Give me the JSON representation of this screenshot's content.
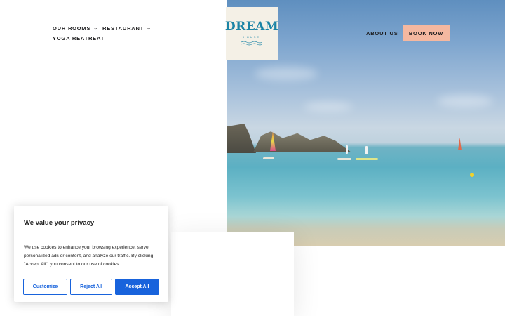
{
  "nav": {
    "left_items": [
      {
        "label": "OUR ROOMS",
        "has_dropdown": true
      },
      {
        "label": "RESTAURANT",
        "has_dropdown": true
      },
      {
        "label": "YOGA REATREAT",
        "has_dropdown": false
      }
    ],
    "right_items": [
      {
        "label": "ABOUT US"
      }
    ],
    "book_now": "BOOK NOW"
  },
  "logo": {
    "word": "DREAM",
    "sub": "HOUSE",
    "icon": "waves-icon"
  },
  "hero": {
    "image_icon": "beach-photo"
  },
  "cookie_banner": {
    "title": "We value your privacy",
    "text": "We use cookies to enhance your browsing experience, serve personalized ads or content, and analyze our traffic. By clicking \"Accept All\", you consent to our use of cookies.",
    "buttons": {
      "customize": "Customize",
      "reject": "Reject All",
      "accept": "Accept All"
    }
  },
  "colors": {
    "accent_button": "#f5b8a0",
    "logo_blue": "#1b84a6",
    "cookie_blue": "#1863dc",
    "logo_bg": "#f4f0e6"
  }
}
